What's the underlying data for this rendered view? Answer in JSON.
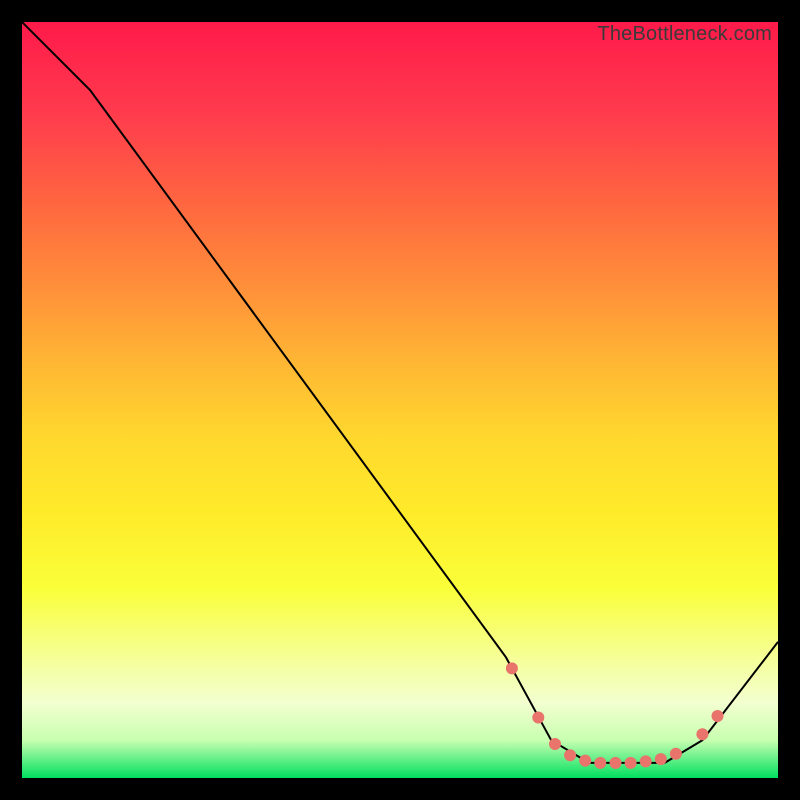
{
  "watermark": "TheBottleneck.com",
  "chart_data": {
    "type": "line",
    "title": "",
    "xlabel": "",
    "ylabel": "",
    "xlim": [
      0,
      100
    ],
    "ylim": [
      0,
      100
    ],
    "series": [
      {
        "name": "bottleneck-curve",
        "points": [
          {
            "x": 0,
            "y": 100
          },
          {
            "x": 9,
            "y": 91
          },
          {
            "x": 64,
            "y": 16
          },
          {
            "x": 70,
            "y": 5
          },
          {
            "x": 75,
            "y": 2
          },
          {
            "x": 85,
            "y": 2
          },
          {
            "x": 90,
            "y": 5
          },
          {
            "x": 100,
            "y": 18
          }
        ]
      }
    ],
    "markers": [
      {
        "x": 64.8,
        "y": 14.5
      },
      {
        "x": 68.3,
        "y": 8.0
      },
      {
        "x": 70.5,
        "y": 4.5
      },
      {
        "x": 72.5,
        "y": 3.0
      },
      {
        "x": 74.5,
        "y": 2.3
      },
      {
        "x": 76.5,
        "y": 2.0
      },
      {
        "x": 78.5,
        "y": 2.0
      },
      {
        "x": 80.5,
        "y": 2.0
      },
      {
        "x": 82.5,
        "y": 2.2
      },
      {
        "x": 84.5,
        "y": 2.5
      },
      {
        "x": 86.5,
        "y": 3.2
      },
      {
        "x": 90.0,
        "y": 5.8
      },
      {
        "x": 92.0,
        "y": 8.2
      }
    ]
  }
}
